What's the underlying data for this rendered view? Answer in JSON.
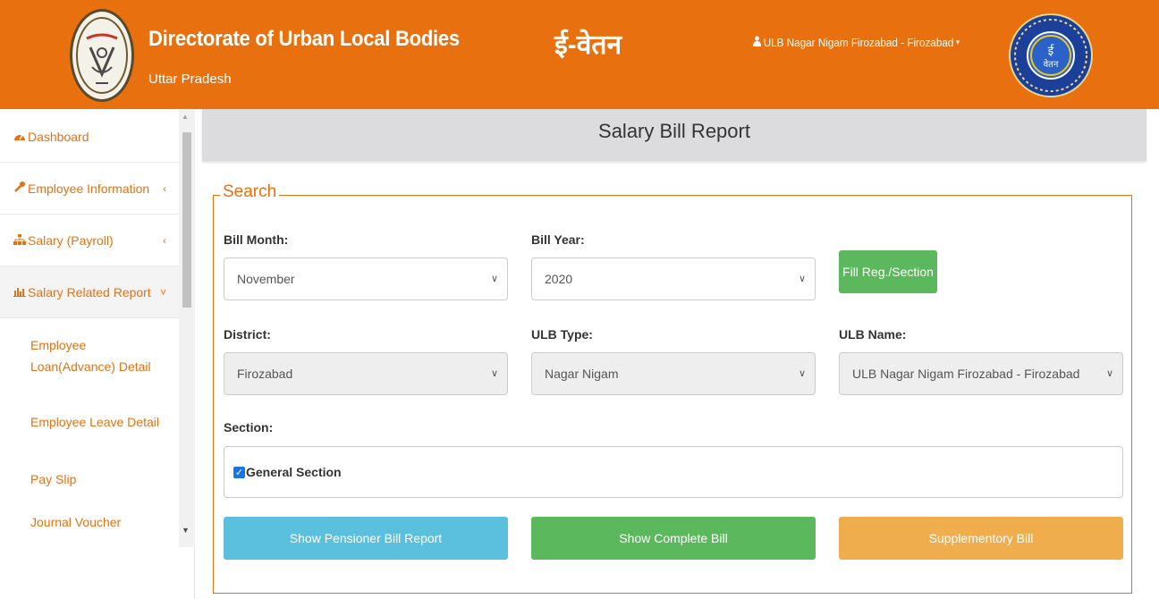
{
  "header": {
    "org_title": "Directorate of Urban Local Bodies",
    "org_subtitle": "Uttar Pradesh",
    "app_name": "ई-वेतन",
    "user_label": "ULB Nagar Nigam Firozabad - Firozabad",
    "colors": {
      "header_bg": "#e8700f"
    }
  },
  "sidebar": {
    "items": [
      {
        "label": "Dashboard",
        "icon": "dashboard-icon"
      },
      {
        "label": "Employee Information",
        "icon": "wrench-icon"
      },
      {
        "label": "Salary (Payroll)",
        "icon": "sitemap-icon"
      },
      {
        "label": "Salary Related Report",
        "icon": "bar-chart-icon"
      }
    ],
    "sub_items": [
      {
        "label": "Employee Loan(Advance) Detail"
      },
      {
        "label": "Employee Leave Detail"
      },
      {
        "label": "Pay Slip"
      },
      {
        "label": "Journal Voucher"
      }
    ]
  },
  "main": {
    "page_title": "Salary Bill Report",
    "search_legend": "Search",
    "fields": {
      "bill_month": {
        "label": "Bill Month:",
        "value": "November"
      },
      "bill_year": {
        "label": "Bill Year:",
        "value": "2020"
      },
      "district": {
        "label": "District:",
        "value": "Firozabad"
      },
      "ulb_type": {
        "label": "ULB Type:",
        "value": "Nagar Nigam"
      },
      "ulb_name": {
        "label": "ULB Name:",
        "value": "ULB Nagar Nigam Firozabad - Firozabad"
      },
      "section": {
        "label": "Section:",
        "option": "General Section",
        "checked": true
      }
    },
    "buttons": {
      "fill_reg": {
        "label": "Fill Reg./Section",
        "color": "#5cb85c"
      },
      "pensioner": {
        "label": "Show Pensioner Bill Report",
        "color": "#5bc0de"
      },
      "complete": {
        "label": "Show Complete Bill",
        "color": "#5cb85c"
      },
      "supplementary": {
        "label": "Supplementory Bill",
        "color": "#f0ad4e"
      }
    }
  }
}
